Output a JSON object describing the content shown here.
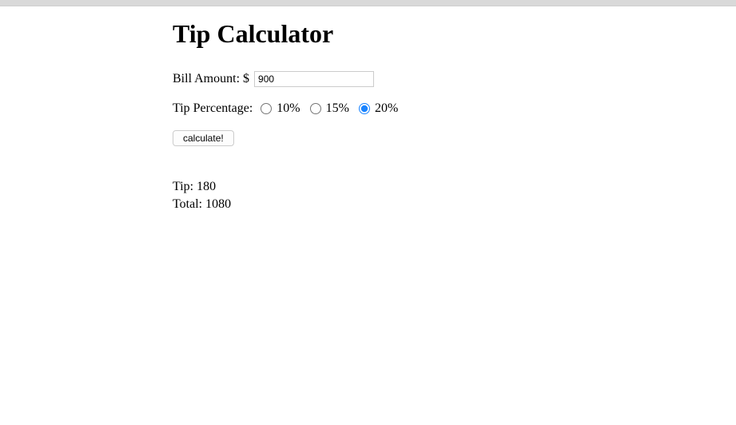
{
  "title": "Tip Calculator",
  "bill": {
    "label": "Bill Amount: $",
    "value": "900"
  },
  "tip_percentage": {
    "label": "Tip Percentage:",
    "options": {
      "opt10": "10%",
      "opt15": "15%",
      "opt20": "20%"
    },
    "selected": "20%"
  },
  "calculate_label": "calculate!",
  "results": {
    "tip_label": "Tip:",
    "tip_value": "180",
    "total_label": "Total:",
    "total_value": "1080"
  }
}
